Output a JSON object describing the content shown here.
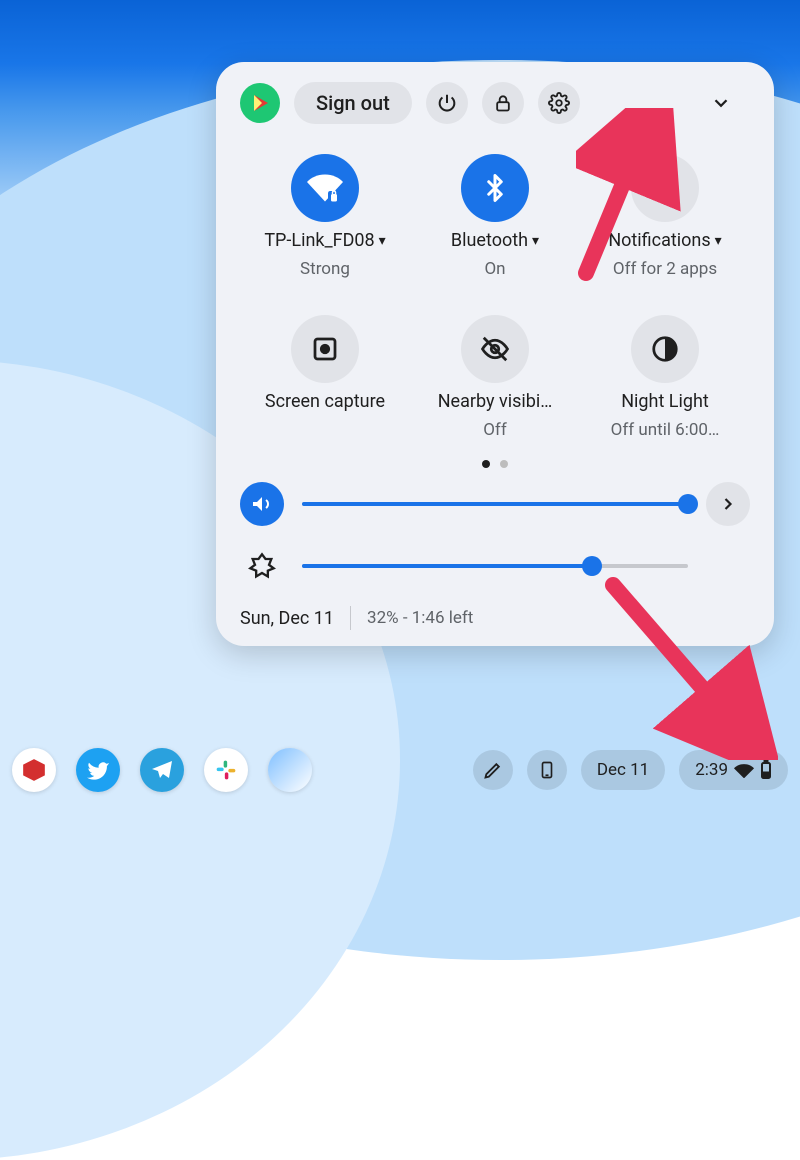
{
  "header": {
    "sign_out_label": "Sign out"
  },
  "tiles": {
    "wifi": {
      "title": "TP-Link_FD08",
      "sub": "Strong"
    },
    "bluetooth": {
      "title": "Bluetooth",
      "sub": "On"
    },
    "notifications": {
      "title": "Notifications",
      "sub": "Off for 2 apps"
    },
    "screen_capture": {
      "title": "Screen capture",
      "sub": ""
    },
    "nearby": {
      "title": "Nearby visibi…",
      "sub": "Off"
    },
    "night_light": {
      "title": "Night Light",
      "sub": "Off until 6:00…"
    }
  },
  "sliders": {
    "volume_percent": 100,
    "brightness_percent": 75
  },
  "footer": {
    "date": "Sun, Dec 11",
    "battery": "32% - 1:46 left"
  },
  "shelf": {
    "date_chip": "Dec 11",
    "status_time": "2:39"
  }
}
